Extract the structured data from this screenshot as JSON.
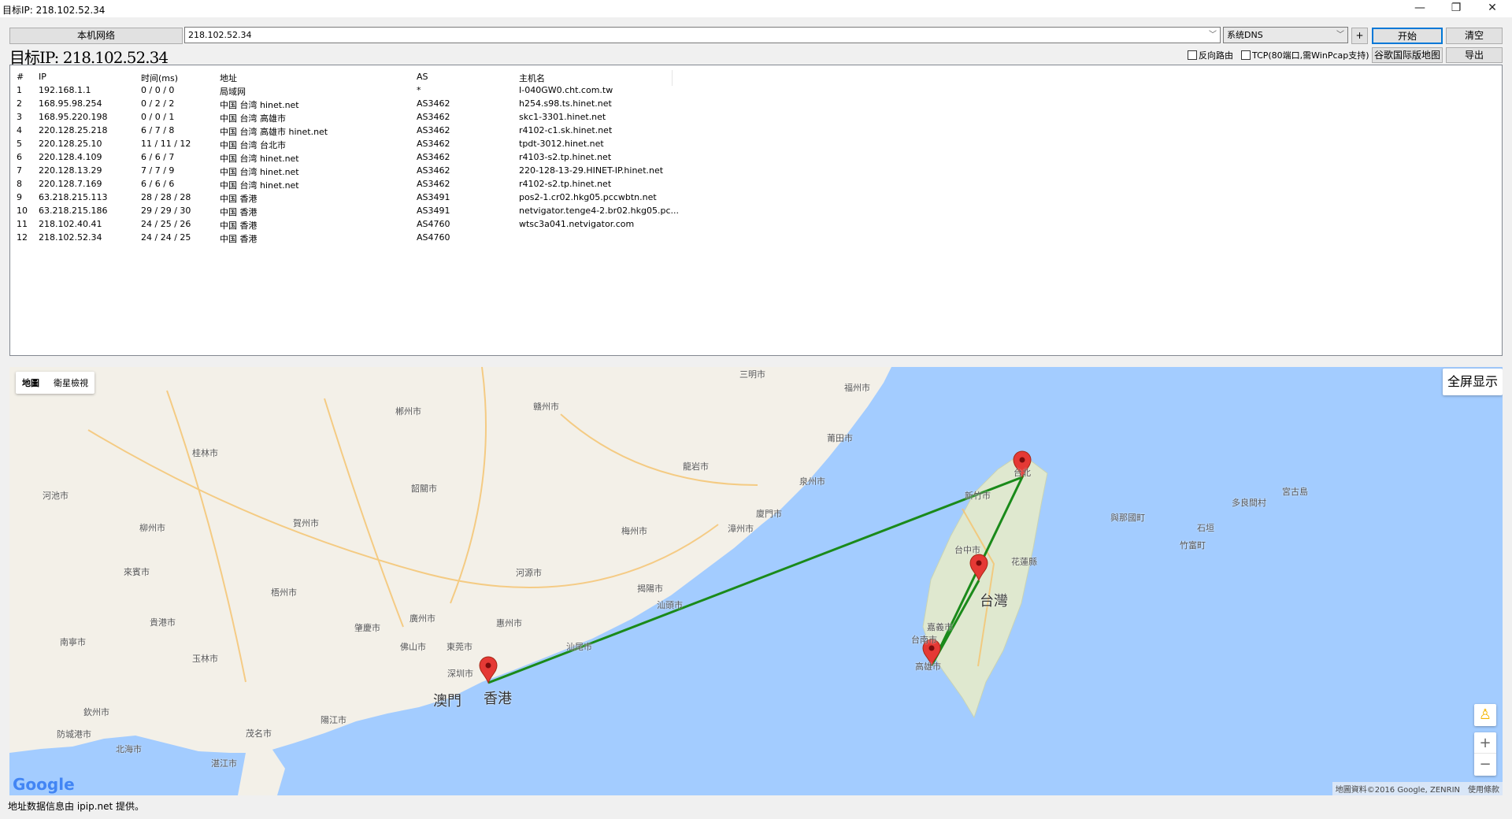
{
  "window": {
    "title": "目标IP: 218.102.52.34",
    "minimize": "—",
    "maximize": "❐",
    "close": "✕"
  },
  "toolbar": {
    "local_network": "本机网络",
    "target_value": "218.102.52.34",
    "dns_value": "系统DNS",
    "plus": "+",
    "start": "开始",
    "clear": "清空",
    "reverse_route": "反向路由",
    "tcp": "TCP(80端口,需WinPcap支持)",
    "google_map": "谷歌国际版地图",
    "export": "导出"
  },
  "target_label": "目标IP: 218.102.52.34",
  "table": {
    "headers": [
      "#",
      "IP",
      "时间(ms)",
      "地址",
      "AS",
      "主机名"
    ],
    "rows": [
      [
        "1",
        "192.168.1.1",
        "0 / 0 / 0",
        "局域网",
        "*",
        "I-040GW0.cht.com.tw"
      ],
      [
        "2",
        "168.95.98.254",
        "0 / 2 / 2",
        "中国 台湾 hinet.net",
        "AS3462",
        "h254.s98.ts.hinet.net"
      ],
      [
        "3",
        "168.95.220.198",
        "0 / 0 / 1",
        "中国 台湾 高雄市",
        "AS3462",
        "skc1-3301.hinet.net"
      ],
      [
        "4",
        "220.128.25.218",
        "6 / 7 / 8",
        "中国 台湾 高雄市 hinet.net",
        "AS3462",
        "r4102-c1.sk.hinet.net"
      ],
      [
        "5",
        "220.128.25.10",
        "11 / 11 / 12",
        "中国 台湾 台北市",
        "AS3462",
        "tpdt-3012.hinet.net"
      ],
      [
        "6",
        "220.128.4.109",
        "6 / 6 / 7",
        "中国 台湾 hinet.net",
        "AS3462",
        "r4103-s2.tp.hinet.net"
      ],
      [
        "7",
        "220.128.13.29",
        "7 / 7 / 9",
        "中国 台湾 hinet.net",
        "AS3462",
        "220-128-13-29.HINET-IP.hinet.net"
      ],
      [
        "8",
        "220.128.7.169",
        "6 / 6 / 6",
        "中国 台湾 hinet.net",
        "AS3462",
        "r4102-s2.tp.hinet.net"
      ],
      [
        "9",
        "63.218.215.113",
        "28 / 28 / 28",
        "中国 香港",
        "AS3491",
        "pos2-1.cr02.hkg05.pccwbtn.net"
      ],
      [
        "10",
        "63.218.215.186",
        "29 / 29 / 30",
        "中国 香港",
        "AS3491",
        "netvigator.tenge4-2.br02.hkg05.pc..."
      ],
      [
        "11",
        "218.102.40.41",
        "24 / 25 / 26",
        "中国 香港",
        "AS4760",
        "wtsc3a041.netvigator.com"
      ],
      [
        "12",
        "218.102.52.34",
        "24 / 24 / 25",
        "中国 香港",
        "AS4760",
        ""
      ]
    ]
  },
  "map": {
    "type_map": "地圖",
    "type_satellite": "衛星檢視",
    "fullscreen": "全屏显示",
    "attribution": "地圖資料©2016 Google, ZENRIN",
    "terms": "使用條款",
    "logo": "Google",
    "zoom_in": "+",
    "zoom_out": "−",
    "cities": [
      "三明市",
      "福州市",
      "郴州市",
      "赣州市",
      "莆田市",
      "桂林市",
      "龍岩市",
      "泉州市",
      "韶關市",
      "河池市",
      "賀州市",
      "柳州市",
      "梅州市",
      "廈門市",
      "漳州市",
      "來賓市",
      "河源市",
      "梧州市",
      "揭陽市",
      "汕頭市",
      "廣州市",
      "惠州市",
      "肇慶市",
      "佛山市",
      "東莞市",
      "汕尾市",
      "南寧市",
      "貴港市",
      "玉林市",
      "深圳市",
      "澳門",
      "香港",
      "陽江市",
      "欽州市",
      "防城港市",
      "北海市",
      "茂名市",
      "湛江市",
      "新竹市",
      "台北",
      "台中市",
      "花蓮縣",
      "台灣",
      "嘉義市",
      "台南市",
      "高雄市",
      "與那國町",
      "石垣",
      "竹富町",
      "多良間村",
      "宮古島"
    ],
    "big_cities": [
      "澳門",
      "香港",
      "台灣"
    ],
    "route_color": "#1a8a1a",
    "marker_color": "#e53935"
  },
  "status": "地址数据信息由 ipip.net 提供。"
}
